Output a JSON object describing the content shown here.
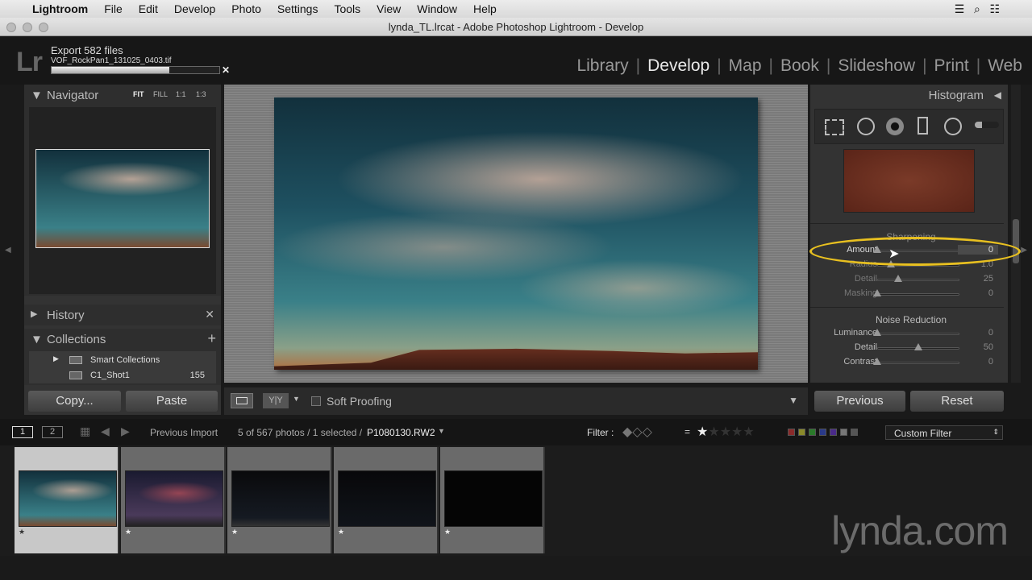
{
  "menubar": {
    "app": "Lightroom",
    "items": [
      "File",
      "Edit",
      "Develop",
      "Photo",
      "Settings",
      "Tools",
      "View",
      "Window",
      "Help"
    ]
  },
  "window_title": "lynda_TL.lrcat - Adobe Photoshop Lightroom - Develop",
  "logo": "Lr",
  "export": {
    "title": "Export 582 files",
    "file": "VOF_RockPan1_131025_0403.tif",
    "progress_percent": 70
  },
  "modules": [
    "Library",
    "Develop",
    "Map",
    "Book",
    "Slideshow",
    "Print",
    "Web"
  ],
  "active_module": "Develop",
  "navigator": {
    "title": "Navigator",
    "zoom": [
      "FIT",
      "FILL",
      "1:1",
      "1:3"
    ]
  },
  "history": {
    "title": "History"
  },
  "collections": {
    "title": "Collections",
    "items": [
      {
        "name": "Smart Collections",
        "count": ""
      },
      {
        "name": "C1_Shot1",
        "count": "155"
      }
    ]
  },
  "left_buttons": {
    "copy": "Copy...",
    "paste": "Paste"
  },
  "toolbar": {
    "soft_proofing": "Soft Proofing",
    "yy": "Y|Y"
  },
  "right": {
    "histogram": "Histogram",
    "sharpening": {
      "title": "Sharpening",
      "sliders": [
        {
          "label": "Amount",
          "value": "0",
          "pos": 0
        },
        {
          "label": "Radius",
          "value": "1.0",
          "pos": 0.17
        },
        {
          "label": "Detail",
          "value": "25",
          "pos": 0.25
        },
        {
          "label": "Masking",
          "value": "0",
          "pos": 0
        }
      ]
    },
    "noise": {
      "title": "Noise Reduction",
      "sliders": [
        {
          "label": "Luminance",
          "value": "0",
          "pos": 0
        },
        {
          "label": "Detail",
          "value": "50",
          "pos": 0.5
        },
        {
          "label": "Contrast",
          "value": "0",
          "pos": 0
        }
      ]
    },
    "previous": "Previous",
    "reset": "Reset"
  },
  "filmbar": {
    "screen1": "1",
    "screen2": "2",
    "source": "Previous Import",
    "count": "5 of 567 photos / 1 selected /",
    "filename": "P1080130.RW2",
    "filter_label": "Filter :",
    "equals": "=",
    "custom_filter": "Custom Filter"
  },
  "label_colors": [
    "#8a2a2a",
    "#8a8a2a",
    "#2a7a2a",
    "#2a3a8a",
    "#4a2a8a",
    "#777777",
    "#555555"
  ],
  "highlight_color": "#e8c020",
  "watermark": "lynda.com"
}
